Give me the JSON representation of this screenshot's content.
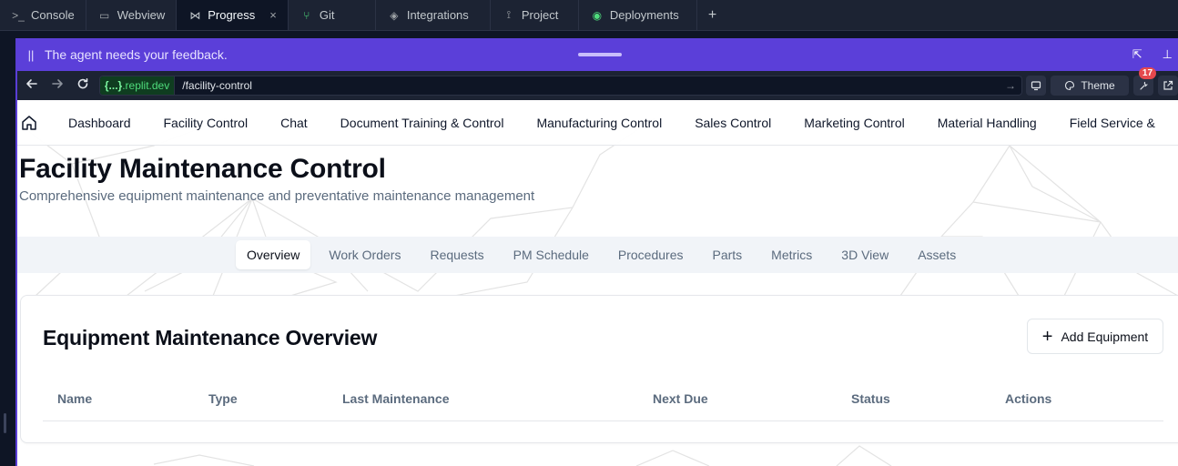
{
  "ide": {
    "tabs": [
      {
        "icon": "terminal-icon",
        "glyph": ">_",
        "label": "Console"
      },
      {
        "icon": "monitor-icon",
        "glyph": "▭",
        "label": "Webview"
      },
      {
        "icon": "progress-icon",
        "glyph": "⋈",
        "label": "Progress",
        "active": true
      },
      {
        "icon": "git-icon",
        "glyph": "⑂",
        "label": "Git"
      },
      {
        "icon": "layers-icon",
        "glyph": "◈",
        "label": "Integrations"
      },
      {
        "icon": "project-icon",
        "glyph": "⟟",
        "label": "Project"
      },
      {
        "icon": "deployments-icon",
        "glyph": "◉",
        "label": "Deployments"
      }
    ],
    "close_glyph": "×",
    "add_glyph": "+"
  },
  "feedback": {
    "message": "The agent needs your feedback.",
    "pause_glyph": "||",
    "popout_glyph": "⇱",
    "pin_glyph": "⊥"
  },
  "browser": {
    "host_brace": "{...}",
    "host": ".replit.dev",
    "path": "/facility-control",
    "go_glyph": "→",
    "theme_label": "Theme",
    "badge_count": "17"
  },
  "app": {
    "nav": [
      "Dashboard",
      "Facility Control",
      "Chat",
      "Document Training & Control",
      "Manufacturing Control",
      "Sales Control",
      "Marketing Control",
      "Material Handling",
      "Field Service &"
    ],
    "title": "Facility Maintenance Control",
    "subtitle": "Comprehensive equipment maintenance and preventative maintenance management",
    "tabs": [
      "Overview",
      "Work Orders",
      "Requests",
      "PM Schedule",
      "Procedures",
      "Parts",
      "Metrics",
      "3D View",
      "Assets"
    ],
    "card": {
      "title": "Equipment Maintenance Overview",
      "add_button": "Add Equipment",
      "add_glyph": "+",
      "columns": [
        "Name",
        "Type",
        "Last Maintenance",
        "Next Due",
        "Status",
        "Actions"
      ]
    }
  },
  "colors": {
    "accent_purple": "#5b3fd9",
    "ide_bg": "#1c2333",
    "host_green": "#4fdc7c",
    "badge_red": "#e5484d"
  }
}
